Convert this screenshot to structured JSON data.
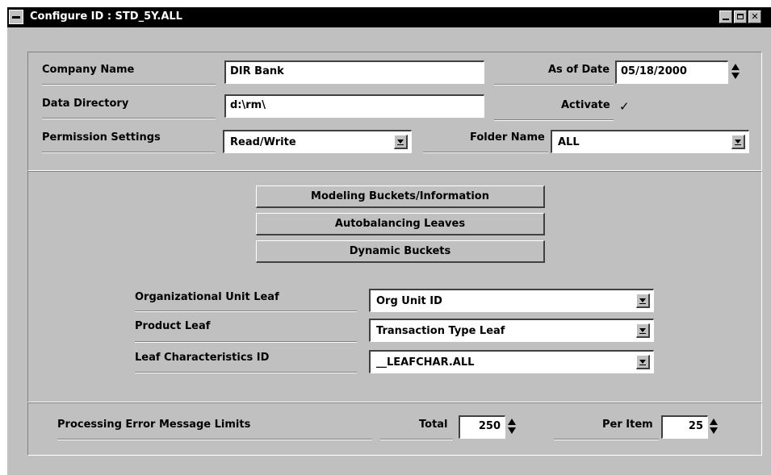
{
  "window": {
    "title": "Configure ID : STD_5Y.ALL"
  },
  "header_panel": {
    "company_name_label": "Company Name",
    "company_name_value": "DIR Bank",
    "as_of_date_label": "As of Date",
    "as_of_date_value": "05/18/2000",
    "data_directory_label": "Data Directory",
    "data_directory_value": "d:\\rm\\",
    "activate_label": "Activate",
    "activate_checked": true,
    "activate_mark": "✓",
    "permission_label": "Permission Settings",
    "permission_value": "Read/Write",
    "folder_label": "Folder Name",
    "folder_value": "ALL"
  },
  "buttons": {
    "modeling": "Modeling Buckets/Information",
    "autobalancing": "Autobalancing Leaves",
    "dynamic": "Dynamic Buckets"
  },
  "leaves": {
    "org_label": "Organizational Unit Leaf",
    "org_value": "Org Unit ID",
    "product_label": "Product Leaf",
    "product_value": "Transaction Type Leaf",
    "leafchar_label": "Leaf Characteristics ID",
    "leafchar_value": "__LEAFCHAR.ALL"
  },
  "limits": {
    "label": "Processing Error Message Limits",
    "total_label": "Total",
    "total_value": "250",
    "per_item_label": "Per Item",
    "per_item_value": "25"
  },
  "icons": [
    "system-menu-icon",
    "minimize-icon",
    "maximize-icon",
    "close-icon",
    "spin-arrows-icon",
    "dropdown-arrow-icon",
    "checkmark-icon"
  ]
}
